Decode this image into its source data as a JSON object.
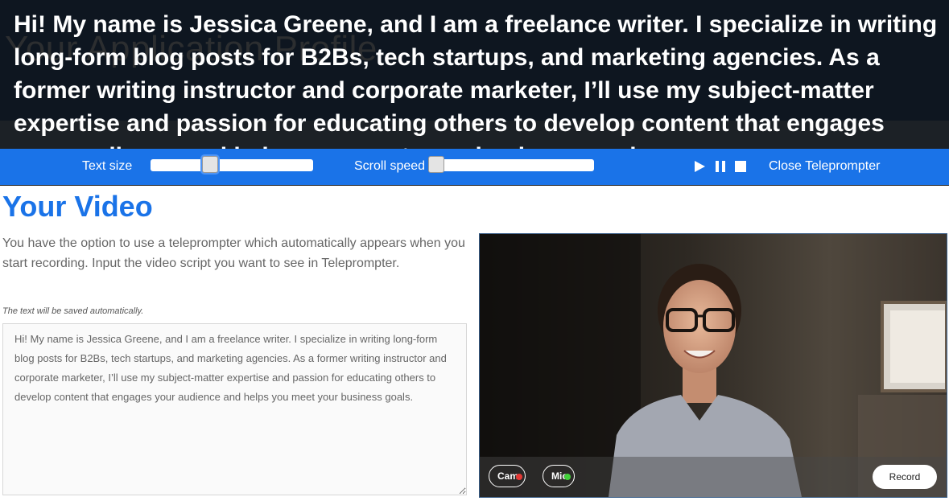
{
  "teleprompter": {
    "script_text": "Hi! My name is Jessica Greene, and I am a freelance writer. I specialize in writing long-form blog posts for B2Bs, tech startups, and marketing agencies. As a former writing instructor and corporate marketer, I’ll use my subject-matter expertise and passion for educating others to develop content that engages your audience and helps you meet your business goals.",
    "background_heading": "Your Application Profile",
    "controls": {
      "text_size_label": "Text size",
      "text_size_level": 0.35,
      "scroll_speed_label": "Scroll speed",
      "scroll_speed_level": 0.0,
      "close_label": "Close Teleprompter",
      "play_icon": "play-icon",
      "pause_icon": "pause-icon",
      "stop_icon": "stop-icon"
    }
  },
  "page": {
    "title": "Your Video",
    "intro": "You have the option to use a teleprompter which automatically appears when you start recording. Input the video script you want to see in Teleprompter.",
    "autosave_note": "The text will be saved automatically.",
    "script_value": "Hi! My name is Jessica Greene, and I am a freelance writer. I specialize in writing long-form blog posts for B2Bs, tech startups, and marketing agencies. As a former writing instructor and corporate marketer, I’ll use my subject-matter expertise and passion for educating others to develop content that engages your audience and helps you meet your business goals."
  },
  "video": {
    "cam_label": "Cam",
    "mic_label": "Mic",
    "record_label": "Record",
    "cam_status_color": "#e53935",
    "mic_status_color": "#43d13a"
  },
  "colors": {
    "accent": "#1a73e8",
    "prompter_bg": "#0e1620"
  }
}
